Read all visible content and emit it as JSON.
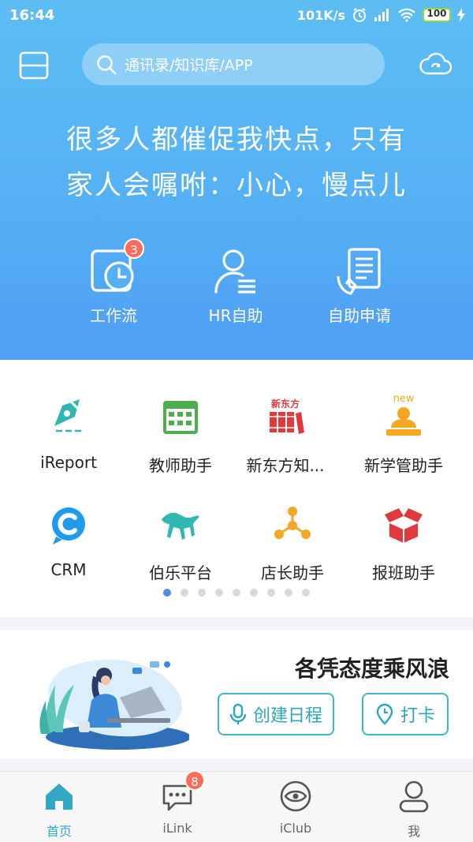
{
  "status_bar": {
    "time": "16:44",
    "speed": "101K/s",
    "battery": "100"
  },
  "search": {
    "placeholder": "通讯录/知识库/APP"
  },
  "slogan": {
    "line1": "很多人都催促我快点，只有",
    "line2": "家人会嘱咐：小心，慢点儿"
  },
  "quick_actions": [
    {
      "label": "工作流",
      "icon": "clock-card-icon",
      "badge": "3"
    },
    {
      "label": "HR自助",
      "icon": "person-list-icon"
    },
    {
      "label": "自助申请",
      "icon": "hand-document-icon"
    }
  ],
  "apps": [
    {
      "label": "iReport",
      "icon": "pen-nib-icon",
      "color": "#2fb7b0"
    },
    {
      "label": "教师助手",
      "icon": "calendar-icon",
      "color": "#4cae4c"
    },
    {
      "label": "新东方知...",
      "icon": "xdf-books-icon",
      "color": "#e0393e",
      "icon_text": "新东方"
    },
    {
      "label": "新学管助手",
      "icon": "person-podium-icon",
      "color": "#f5a623",
      "tag": "new"
    },
    {
      "label": "CRM",
      "icon": "crm-c-icon",
      "color": "#1e9bea"
    },
    {
      "label": "伯乐平台",
      "icon": "horse-icon",
      "color": "#2fb7b0"
    },
    {
      "label": "店长助手",
      "icon": "network-nodes-icon",
      "color": "#f5a623"
    },
    {
      "label": "报班助手",
      "icon": "open-box-icon",
      "color": "#e0393e"
    }
  ],
  "pager": {
    "count": 9,
    "active": 0
  },
  "banner": {
    "motto": "各凭态度乘风浪",
    "schedule_label": "创建日程",
    "checkin_label": "打卡"
  },
  "tabs": [
    {
      "label": "首页",
      "icon": "home-icon",
      "active": true
    },
    {
      "label": "iLink",
      "icon": "chat-bubble-icon",
      "badge": "8"
    },
    {
      "label": "iClub",
      "icon": "eye-icon"
    },
    {
      "label": "我",
      "icon": "user-icon"
    }
  ],
  "colors": {
    "accent": "#33a8c4",
    "hero_top": "#5cbdf3",
    "hero_bottom": "#4f9ef5",
    "badge": "#ff6b5b"
  }
}
